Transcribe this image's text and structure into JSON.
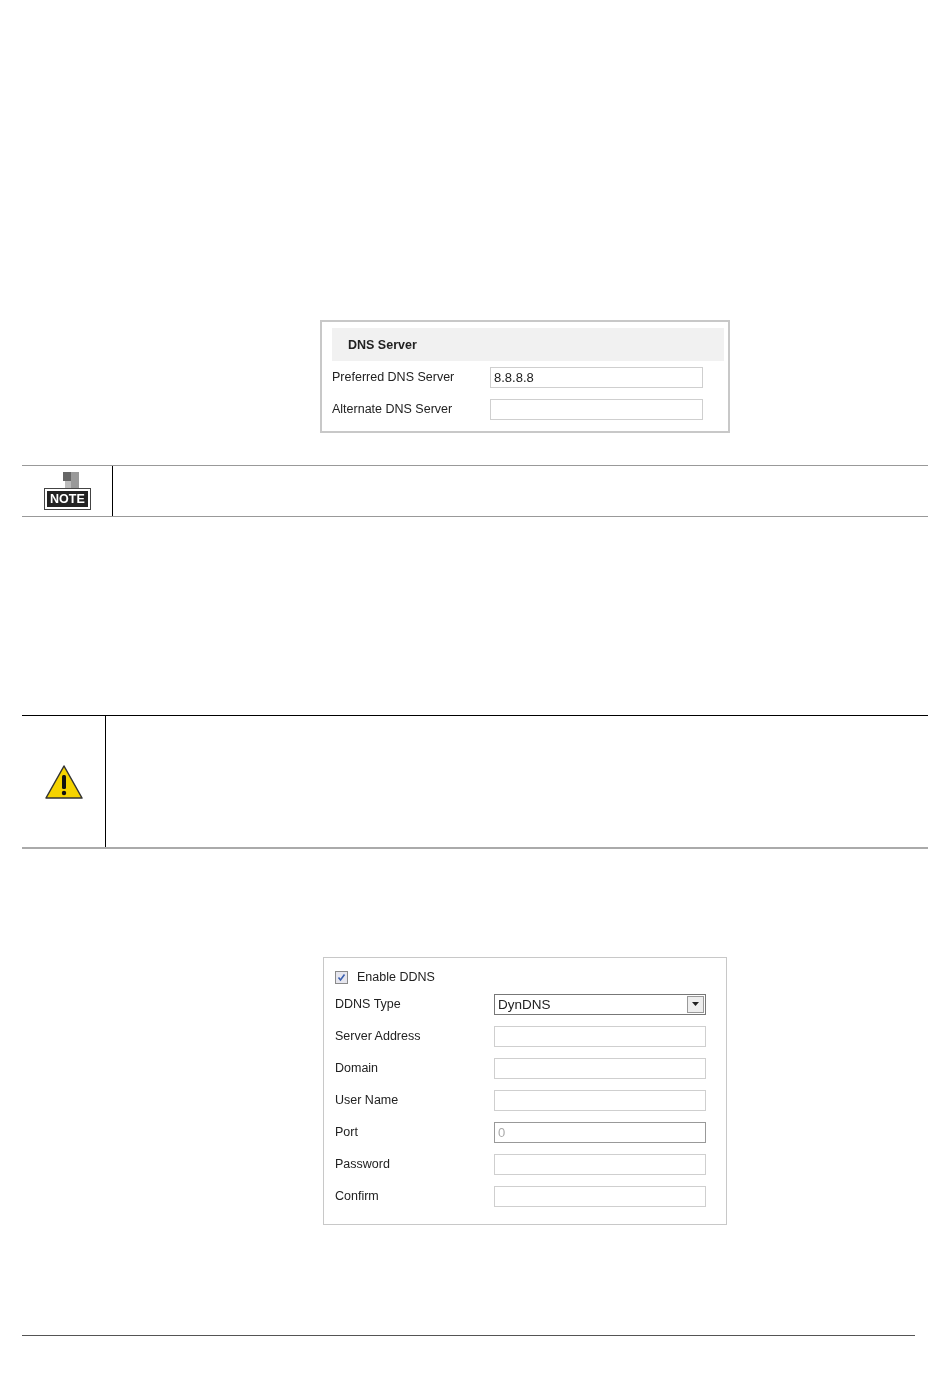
{
  "dns_panel": {
    "title": "DNS Server",
    "fields": [
      {
        "label": "Preferred DNS Server",
        "value": "8.8.8.8"
      },
      {
        "label": "Alternate DNS Server"
      }
    ]
  },
  "note": {
    "badge": "NOTE"
  },
  "ddns_panel": {
    "enable": {
      "label": "Enable DDNS",
      "checked": true
    },
    "fields": [
      {
        "kind": "select",
        "label": "DDNS Type",
        "value": "DynDNS"
      },
      {
        "kind": "text",
        "label": "Server Address"
      },
      {
        "kind": "text",
        "label": "Domain"
      },
      {
        "kind": "text",
        "label": "User Name"
      },
      {
        "kind": "text",
        "label": "Port",
        "placeholder": "0"
      },
      {
        "kind": "text",
        "label": "Password"
      },
      {
        "kind": "text",
        "label": "Confirm"
      }
    ]
  }
}
